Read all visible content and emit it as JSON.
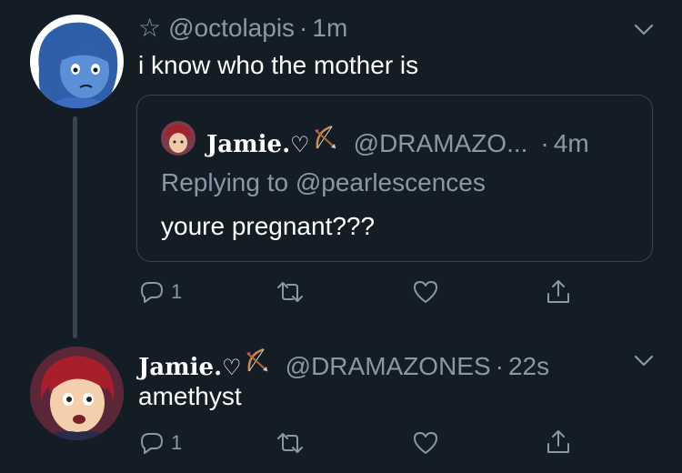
{
  "tweet1": {
    "star": "☆",
    "handle": "@octolapis",
    "sep": "·",
    "time": "1m",
    "text": "i know who the mother is",
    "avatar": "lapis-avatar"
  },
  "quote": {
    "display_name": "Jamie.",
    "name_emoji": "♡",
    "bow_emoji": "bow-and-arrow-icon",
    "handle": "@DRAMAZO...",
    "sep": "·",
    "time": "4m",
    "replying_to": "Replying to @pearlescences",
    "text": "youre pregnant???"
  },
  "actions1": {
    "reply_count": "1",
    "icons": [
      "reply-icon",
      "retweet-icon",
      "like-icon",
      "share-icon"
    ]
  },
  "tweet2": {
    "display_name": "Jamie.",
    "name_emoji": "♡",
    "handle": "@DRAMAZONES",
    "sep": "·",
    "time": "22s",
    "text": "amethyst",
    "avatar": "jamie-avatar"
  },
  "actions2": {
    "reply_count": "1"
  },
  "colors": {
    "background": "#141d26",
    "muted": "#8899a6",
    "border": "#38444d",
    "text": "#ffffff"
  }
}
